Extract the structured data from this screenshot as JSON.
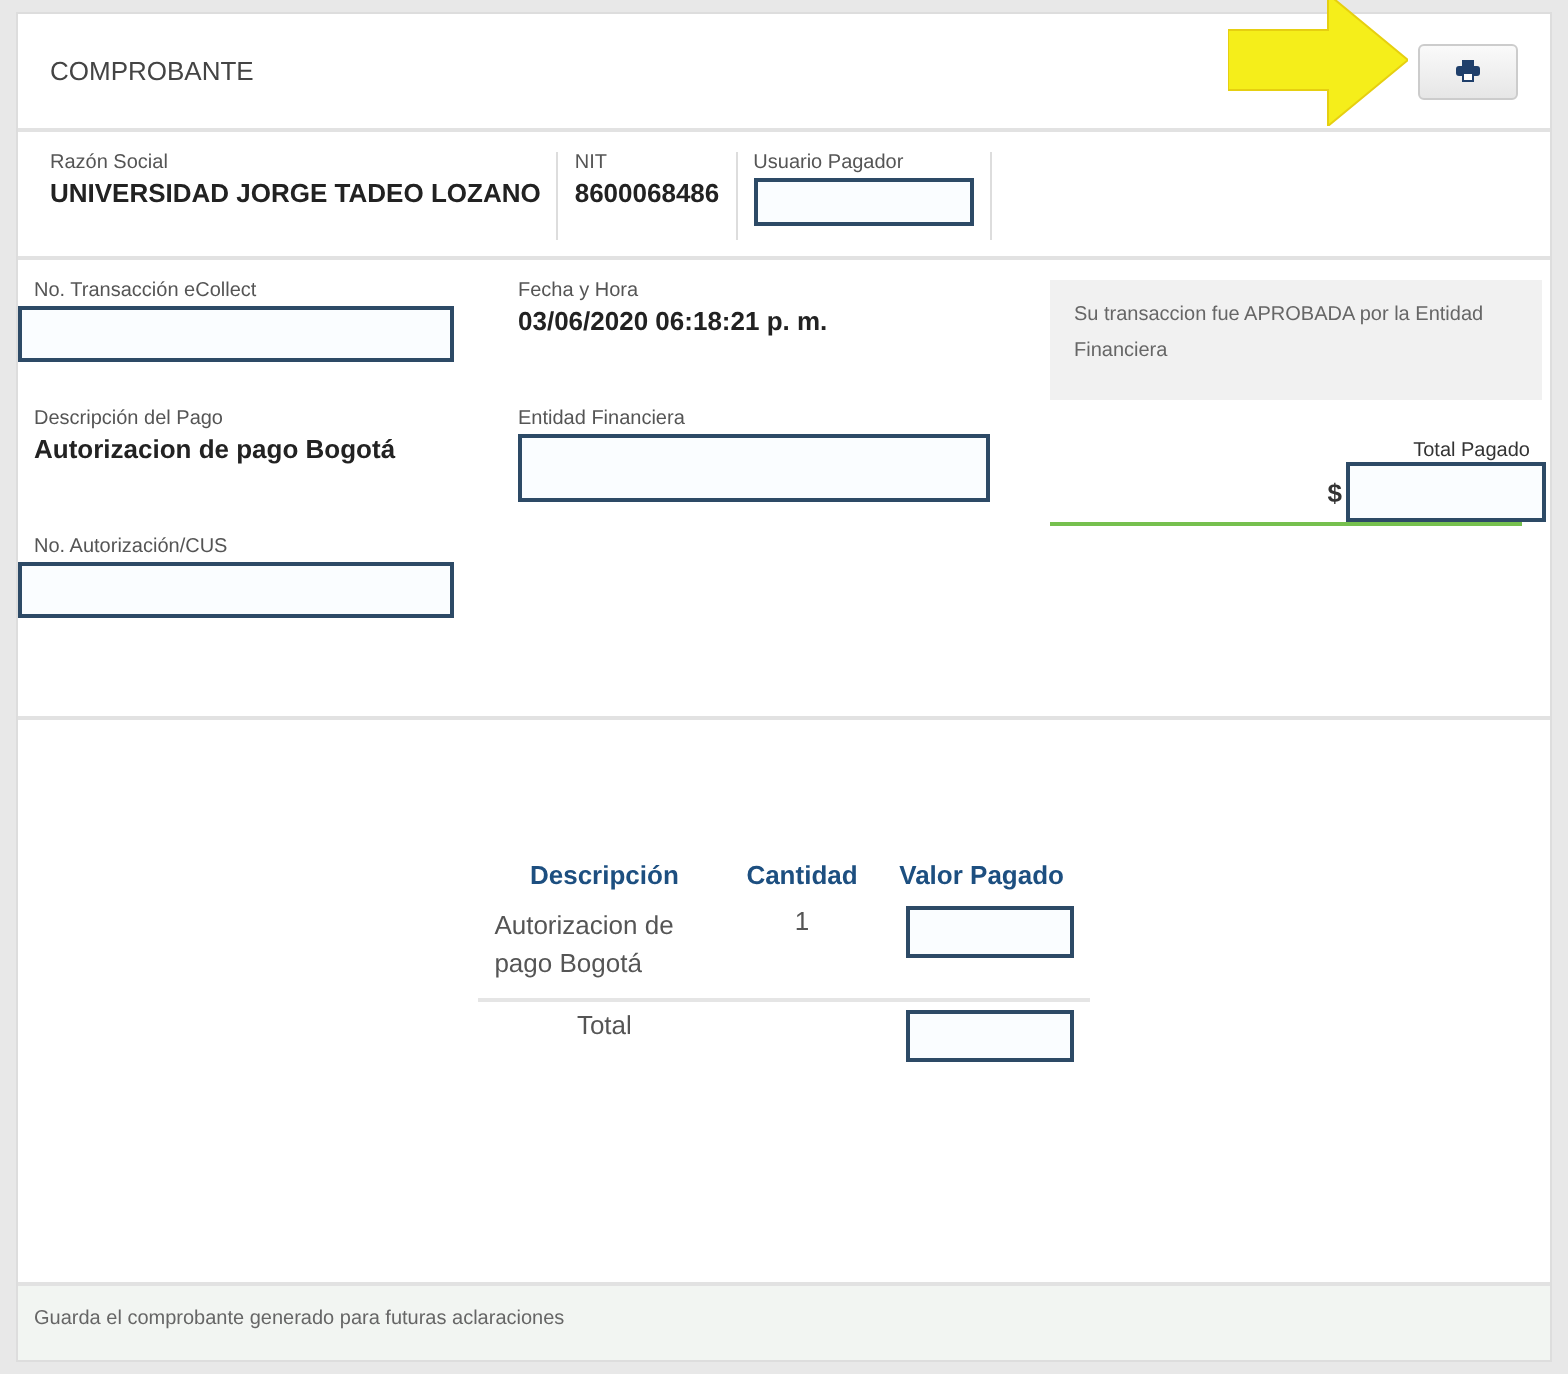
{
  "header": {
    "title": "COMPROBANTE"
  },
  "company": [
    {
      "label": "Razón Social",
      "kind": "text",
      "value": "UNIVERSIDAD JORGE TADEO LOZANO"
    },
    {
      "label": "NIT",
      "kind": "text",
      "value": "8600068486"
    },
    {
      "label": "Usuario Pagador",
      "kind": "redacted"
    }
  ],
  "details_left": [
    {
      "label": "No. Transacción eCollect",
      "kind": "redacted"
    },
    {
      "label": "Descripción del Pago",
      "kind": "text",
      "value": "Autorizacion de pago Bogotá"
    },
    {
      "label": "No. Autorización/CUS",
      "kind": "redacted"
    }
  ],
  "details_middle": [
    {
      "label": "Fecha y Hora",
      "kind": "text",
      "value": "03/06/2020 06:18:21 p. m."
    },
    {
      "label": "Entidad Financiera",
      "kind": "redacted"
    }
  ],
  "status": {
    "message": "Su transaccion fue APROBADA por la Entidad Financiera",
    "total_label": "Total Pagado",
    "currency": "$"
  },
  "table": {
    "columns": [
      "Descripción",
      "Cantidad",
      "Valor Pagado"
    ],
    "rows": [
      {
        "description": "Autorizacion de pago Bogotá",
        "quantity": "1"
      }
    ],
    "total": {
      "label": "Total"
    }
  },
  "footer": "Guarda el comprobante generado para futuras aclaraciones"
}
